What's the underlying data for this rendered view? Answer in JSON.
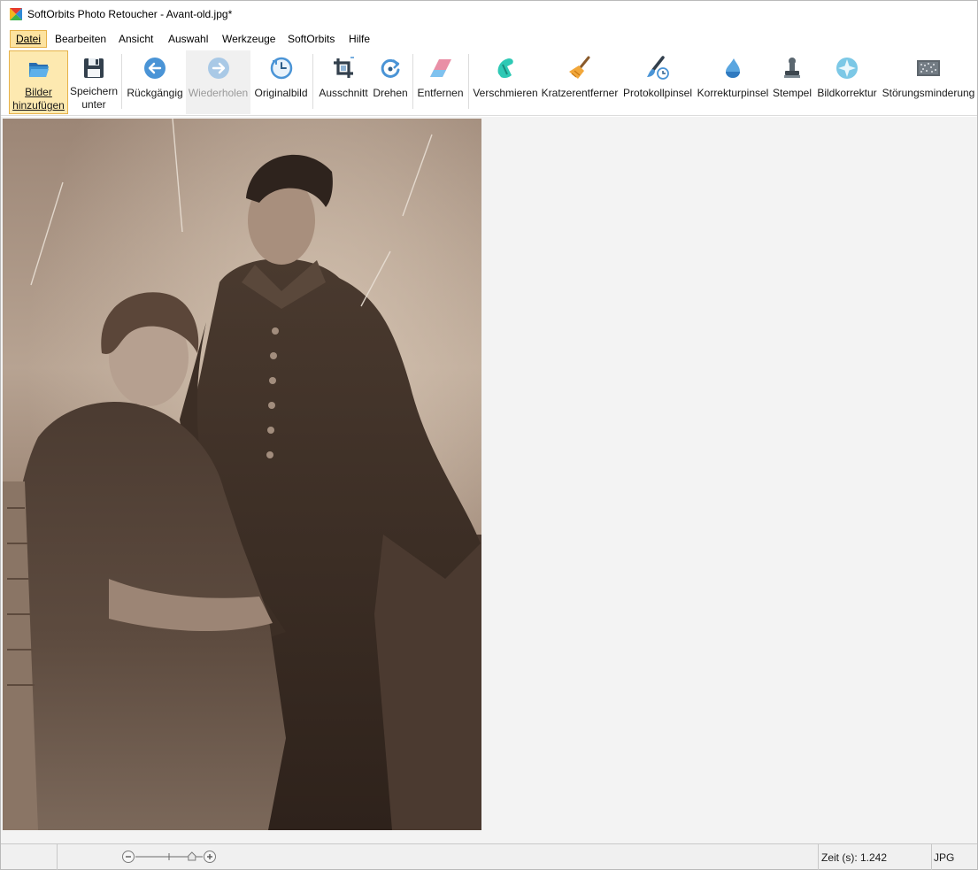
{
  "window": {
    "title": "SoftOrbits Photo Retoucher - Avant-old.jpg*"
  },
  "menu": [
    {
      "label": "Datei",
      "active": true
    },
    {
      "label": "Bearbeiten",
      "active": false
    },
    {
      "label": "Ansicht",
      "active": false
    },
    {
      "label": "Auswahl",
      "active": false
    },
    {
      "label": "Werkzeuge",
      "active": false
    },
    {
      "label": "SoftOrbits",
      "active": false
    },
    {
      "label": "Hilfe",
      "active": false
    }
  ],
  "toolbar": {
    "add_images": {
      "line1": "Bilder",
      "line2": "hinzufügen",
      "icon": "folder-open-icon",
      "state": "pressed"
    },
    "save_as": {
      "line1": "Speichern",
      "line2": "unter",
      "icon": "floppy-disk-icon"
    },
    "undo": {
      "label": "Rückgängig",
      "icon": "arrow-left-circle-icon"
    },
    "redo": {
      "label": "Wiederholen",
      "icon": "arrow-right-circle-icon",
      "state": "disabled"
    },
    "original": {
      "label": "Originalbild",
      "icon": "clock-icon"
    },
    "crop": {
      "label": "Ausschnitt",
      "icon": "crop-icon"
    },
    "rotate": {
      "label": "Drehen",
      "icon": "rotate-icon"
    },
    "remove": {
      "label": "Entfernen",
      "icon": "eraser-icon"
    },
    "smudge": {
      "label": "Verschmieren",
      "icon": "smudge-finger-icon"
    },
    "scratch": {
      "label": "Kratzerentferner",
      "icon": "broom-icon"
    },
    "history_brush": {
      "label": "Protokollpinsel",
      "icon": "history-brush-icon"
    },
    "correction_brush": {
      "label": "Korrekturpinsel",
      "icon": "drop-icon"
    },
    "stamp": {
      "label": "Stempel",
      "icon": "stamp-icon"
    },
    "image_correction": {
      "label": "Bildkorrektur",
      "icon": "sparkle-icon"
    },
    "noise": {
      "label": "Störungsminderung",
      "icon": "noise-icon"
    }
  },
  "canvas": {
    "image_name": "Avant-old.jpg"
  },
  "statusbar": {
    "time": "Zeit (s): 1.242",
    "format": "JPG",
    "zoom_level": 0.84
  },
  "colors": {
    "accent_active": "#fde9b0",
    "accent_border": "#e6b24a",
    "icon_blue": "#3a8fd0",
    "sepia_dark": "#3b2c22",
    "sepia_light": "#c9b7a4"
  }
}
